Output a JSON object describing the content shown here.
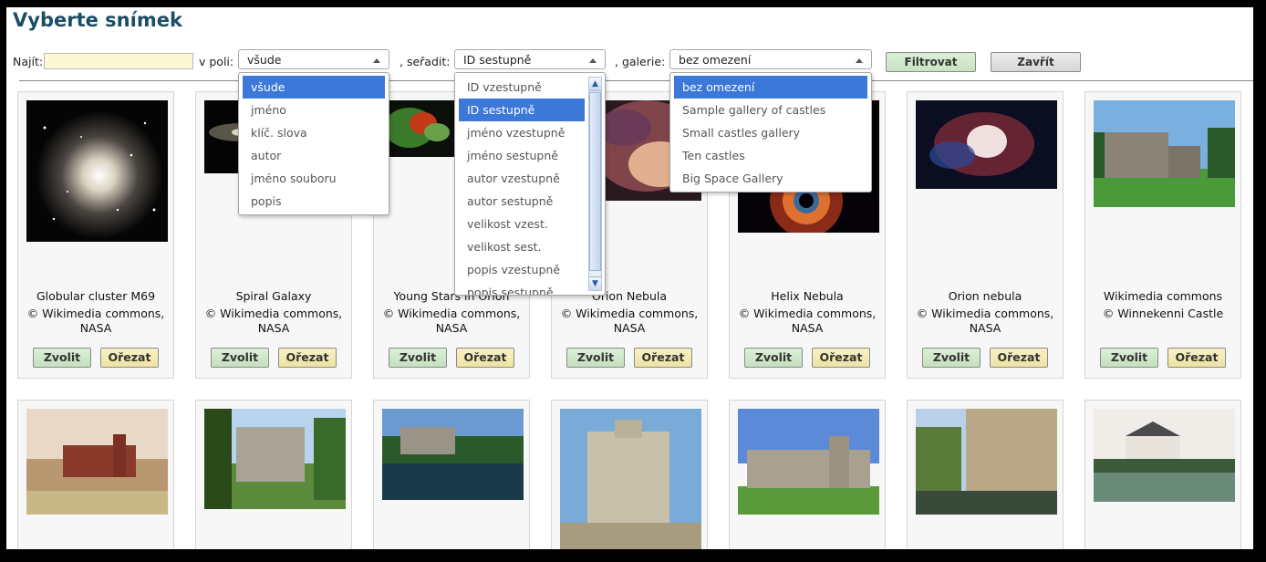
{
  "title": "Vyberte snímek",
  "filter": {
    "find_label": "Najít:",
    "find_value": "",
    "field_label": "v poli:",
    "field_value": "všude",
    "sort_label": ", seřadit:",
    "sort_value": "ID sestupně",
    "gallery_label": ", galerie:",
    "gallery_value": "bez omezení",
    "filter_button": "Filtrovat",
    "close_button": "Zavřít"
  },
  "field_options": [
    "všude",
    "jméno",
    "klíč. slova",
    "autor",
    "jméno souboru",
    "popis"
  ],
  "sort_options": [
    "ID vzestupně",
    "ID sestupně",
    "jméno vzestupně",
    "jméno sestupně",
    "autor vzestupně",
    "autor sestupně",
    "velikost vzest.",
    "velikost sest.",
    "popis vzestupně",
    "popis sestupně"
  ],
  "gallery_options": [
    "bez omezení",
    "Sample gallery of castles",
    "Small castles gallery",
    "Ten castles",
    "Big Space Gallery"
  ],
  "card_buttons": {
    "select": "Zvolit",
    "crop": "Ořezat"
  },
  "row1": [
    {
      "name": "Globular cluster M69",
      "credit": "© Wikimedia commons, NASA"
    },
    {
      "name": "Spiral Galaxy",
      "credit": "© Wikimedia commons, NASA"
    },
    {
      "name": "Young Stars in Orion",
      "credit": "© Wikimedia commons, NASA"
    },
    {
      "name": "Orion Nebula",
      "credit": "© Wikimedia commons, NASA"
    },
    {
      "name": "Helix Nebula",
      "credit": "© Wikimedia commons, NASA"
    },
    {
      "name": "Orion nebula",
      "credit": "© Wikimedia commons, NASA"
    },
    {
      "name": "Wikimedia commons",
      "credit": "© Winnekenni Castle"
    }
  ]
}
